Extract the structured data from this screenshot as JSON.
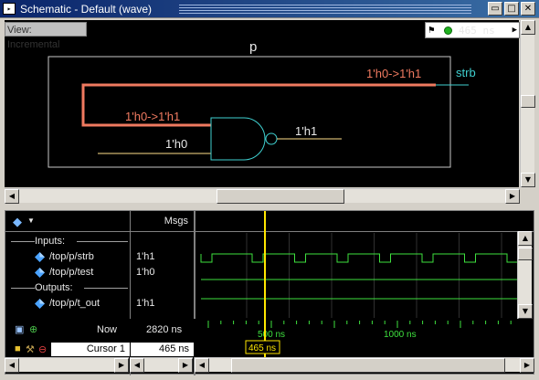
{
  "window": {
    "title": "Schematic - Default (wave)",
    "app_icon": "schematic-icon",
    "buttons": [
      "▪",
      "■",
      "✕"
    ]
  },
  "schematic": {
    "view_label": "View: Incremental",
    "time_value": "465 ns",
    "block_name": "p",
    "output_port": "strb",
    "strb_transition": "1'h0->1'h1",
    "input_a_transition": "1'h0->1'h1",
    "input_b_value": "1'h0",
    "output_value": "1'h1",
    "colors": {
      "active_net": "#f07a60",
      "idle_net": "#ffe08a",
      "gate": "#3fd0d0",
      "port": "#3fd0d0"
    }
  },
  "wave": {
    "header": {
      "msgs": "Msgs",
      "toolbar_icon": "diamond-icon"
    },
    "rows": [
      {
        "type": "group",
        "label": "Inputs:"
      },
      {
        "type": "signal",
        "label": "/top/p/strb",
        "value": "1'h1",
        "selected": true
      },
      {
        "type": "signal",
        "label": "/top/p/test",
        "value": "1'h0"
      },
      {
        "type": "group",
        "label": "Outputs:"
      },
      {
        "type": "signal",
        "label": "/top/p/t_out",
        "value": "1'h1"
      }
    ],
    "now_label": "Now",
    "now_value": "2820 ns",
    "cursor_label": "Cursor 1",
    "cursor_value": "465 ns",
    "time_ticks": [
      "500 ns",
      "1000 ns"
    ],
    "cursor_tag": "465 ns",
    "colors": {
      "wave": "#3ee03e",
      "cursor": "#ffe600",
      "time": "#3ee03e"
    }
  }
}
